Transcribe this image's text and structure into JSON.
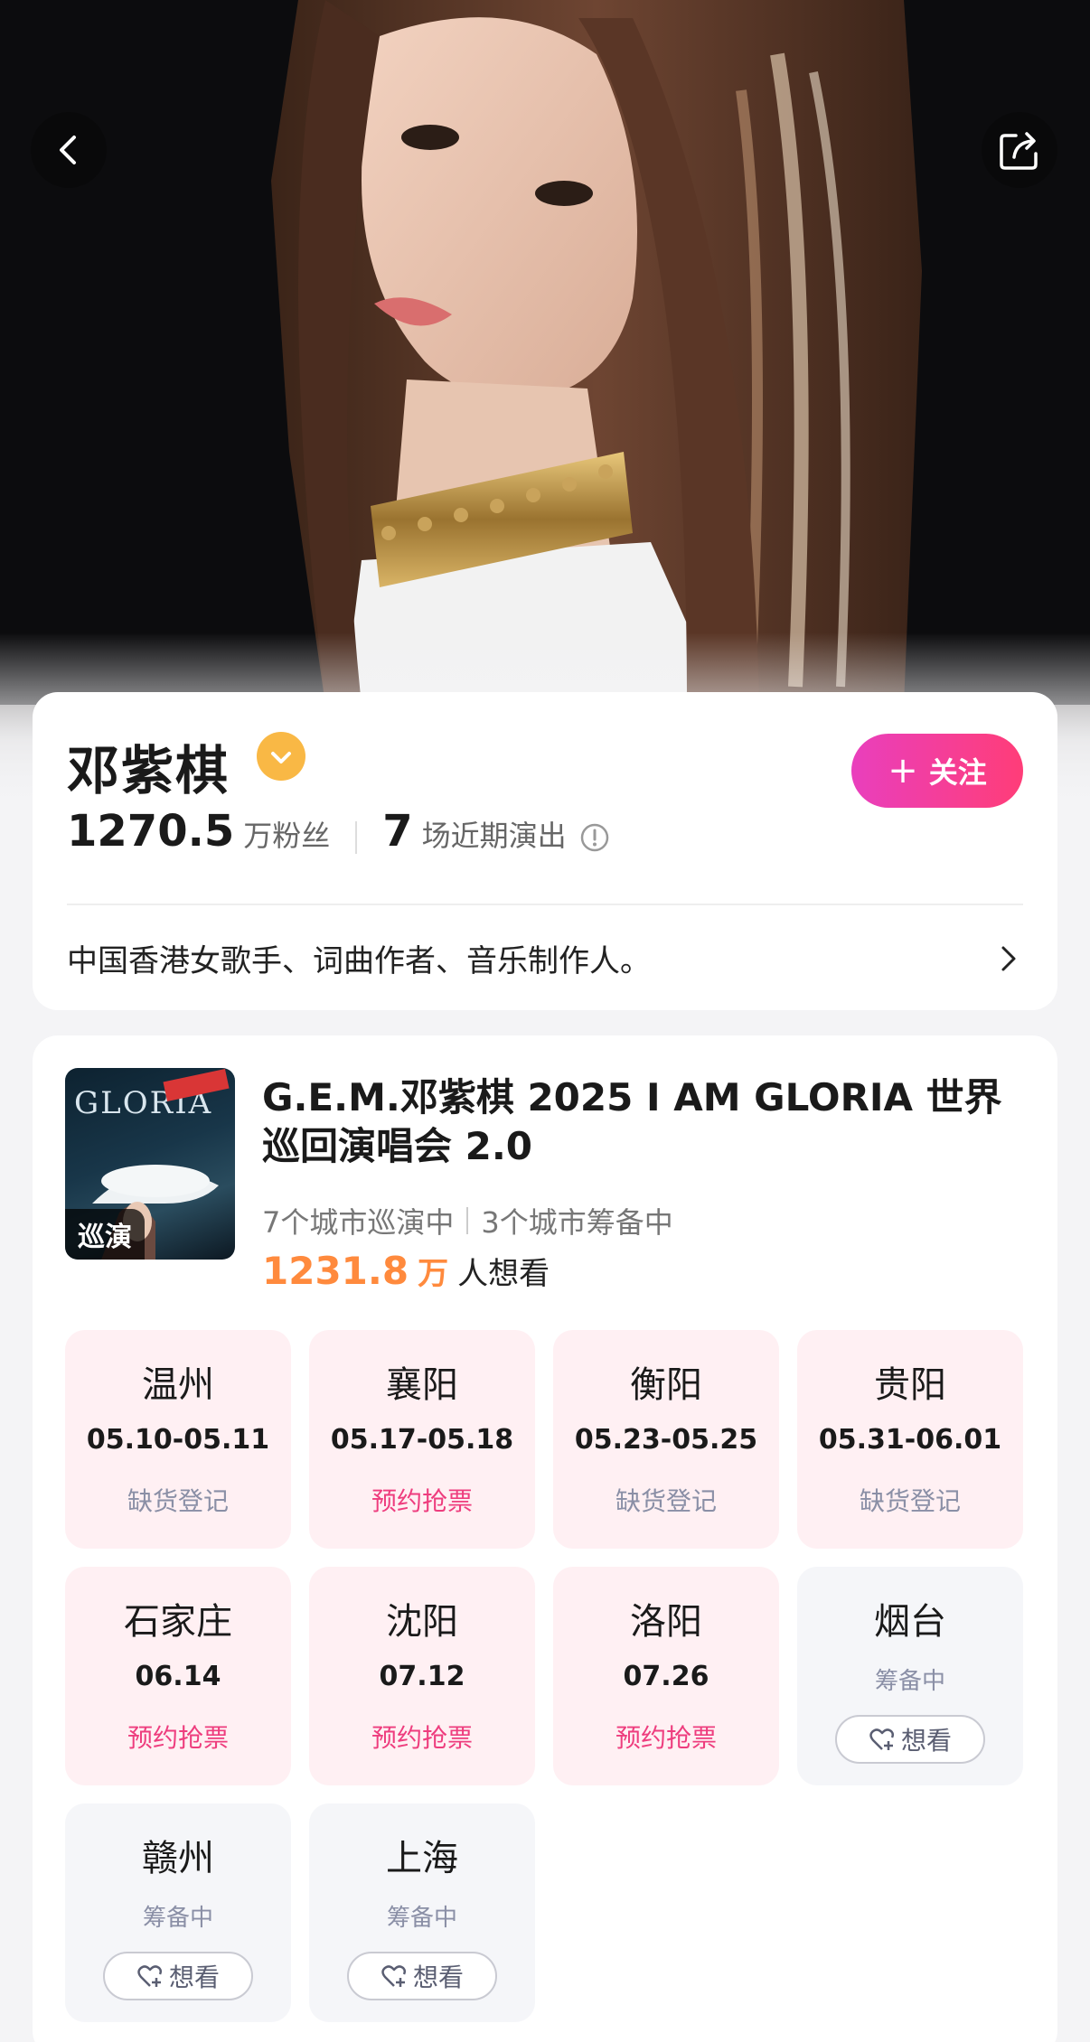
{
  "hero": {
    "back_icon": "chevron-left-icon",
    "share_icon": "share-icon"
  },
  "artist": {
    "name": "邓紫棋",
    "verified_icon": "verified-check-icon",
    "follow_label": "关注",
    "follow_plus": "+",
    "fans_count": "1270.5",
    "fans_unit": "万粉丝",
    "shows_count": "7",
    "shows_label": "场近期演出",
    "bio": "中国香港女歌手、词曲作者、音乐制作人。"
  },
  "tour": {
    "poster_tag": "巡演",
    "title": "G.E.M.邓紫棋 2025 I AM GLORIA 世界巡回演唱会 2.0",
    "cities_touring": "7个城市巡演中",
    "cities_planning": "3个城市筹备中",
    "want_count": "1231.8",
    "want_unit": "万",
    "want_label": "人想看",
    "cities": [
      {
        "name": "温州",
        "date": "05.10-05.11",
        "status": "缺货登记"
      },
      {
        "name": "襄阳",
        "date": "05.17-05.18",
        "status": "预约抢票"
      },
      {
        "name": "衡阳",
        "date": "05.23-05.25",
        "status": "缺货登记"
      },
      {
        "name": "贵阳",
        "date": "05.31-06.01",
        "status": "缺货登记"
      },
      {
        "name": "石家庄",
        "date": "06.14",
        "status": "预约抢票"
      },
      {
        "name": "沈阳",
        "date": "07.12",
        "status": "预约抢票"
      },
      {
        "name": "洛阳",
        "date": "07.26",
        "status": "预约抢票"
      },
      {
        "name": "烟台",
        "prep": "筹备中",
        "want_btn": "想看"
      },
      {
        "name": "赣州",
        "prep": "筹备中",
        "want_btn": "想看"
      },
      {
        "name": "上海",
        "prep": "筹备中",
        "want_btn": "想看"
      }
    ]
  },
  "colors": {
    "accent_pink": "#ee3d7e",
    "accent_orange": "#ff8a3d",
    "verified_gold": "#f9b845"
  }
}
